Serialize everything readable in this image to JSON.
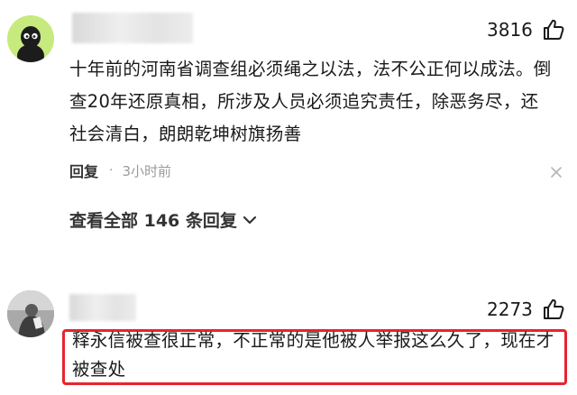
{
  "comments": [
    {
      "avatar": "cartoon-avatar-icon",
      "likes": "3816",
      "text": "十年前的河南省调查组必须绳之以法，法不公正何以成法。倒查20年还原真相，所涉及人员必须追究责任，除恶务尽，还社会清白，朗朗乾坤树旗扬善",
      "reply_label": "回复",
      "separator": "·",
      "time": "3小时前",
      "view_all": "查看全部 146 条回复"
    },
    {
      "avatar": "photo-avatar-icon",
      "likes": "2273",
      "text": "释永信被查很正常，不正常的是他被人举报这么久了，现在才被查处",
      "highlight_color": "#e8232f"
    }
  ],
  "colors": {
    "text": "#1a1a1a",
    "muted": "#9a9a9a",
    "avatar1_bg": "#c7ea7e",
    "highlight": "#e8232f"
  }
}
